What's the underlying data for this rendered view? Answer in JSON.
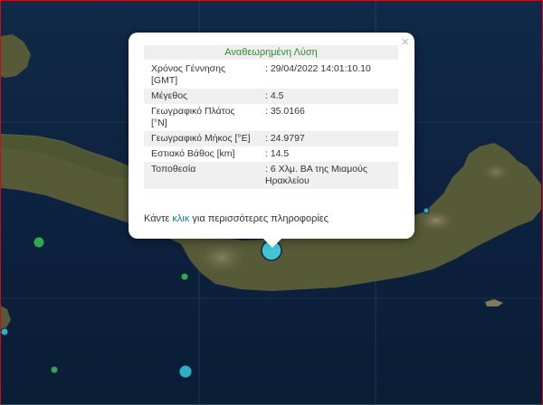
{
  "popup": {
    "title": "Αναθεωρημένη Λύση",
    "close_symbol": "×",
    "rows": [
      {
        "label": "Χρόνος Γέννησης [GMT]",
        "value": ": 29/04/2022 14:01:10.10"
      },
      {
        "label": "Μέγεθος",
        "value": ": 4.5"
      },
      {
        "label": "Γεωγραφικό Πλάτος [°N]",
        "value": ": 35.0166"
      },
      {
        "label": "Γεωγραφικό Μήκος [°E]",
        "value": ": 24.9797"
      },
      {
        "label": "Εστιακό Βάθος [km]",
        "value": ": 14.5"
      },
      {
        "label": "Τοποθεσία",
        "value": ": 6 Χλμ. ΒΑ της Μιαμούς Ηρακλείου"
      }
    ],
    "more_prefix": "Κάντε ",
    "more_link": "κλικ",
    "more_suffix": " για περισσότερες πληροφορίες"
  },
  "colors": {
    "sea": "#0e2540",
    "land": "#565a36",
    "mountain": "#7c7655",
    "grid": "#5f6f84",
    "selected_marker": "#3fc5d3",
    "cyan_marker": "#2ab1c9",
    "green_marker": "#2fa84f",
    "frame": "#c1121a",
    "title_text": "#2f8a2f",
    "link": "#1a73b8"
  },
  "markers": [
    {
      "icon": "selected-earthquake-marker",
      "color": "cyan",
      "selected": true
    },
    {
      "icon": "earthquake-marker",
      "color": "green"
    },
    {
      "icon": "earthquake-marker",
      "color": "green"
    },
    {
      "icon": "earthquake-marker",
      "color": "green"
    },
    {
      "icon": "earthquake-marker",
      "color": "cyan"
    },
    {
      "icon": "earthquake-marker",
      "color": "cyan"
    },
    {
      "icon": "earthquake-marker",
      "color": "cyan"
    }
  ]
}
